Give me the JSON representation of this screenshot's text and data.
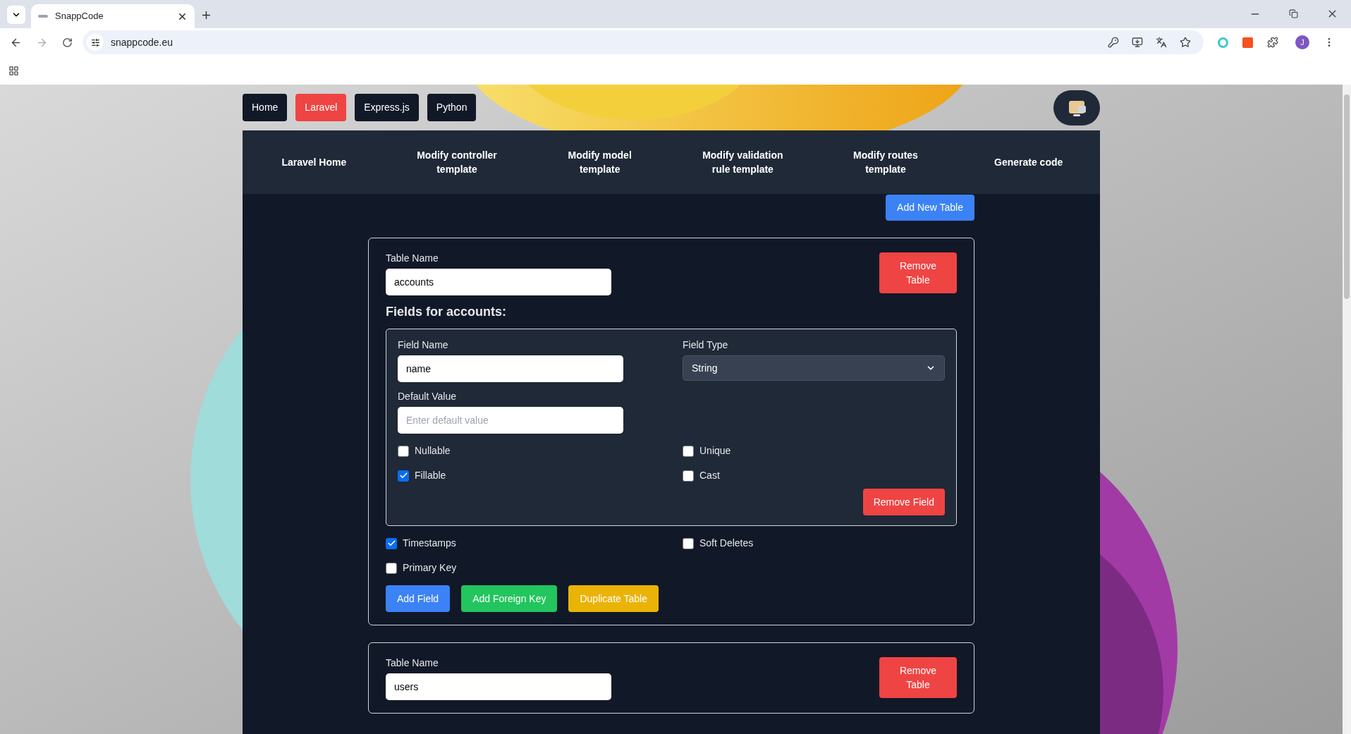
{
  "browser": {
    "tab_title": "SnappCode",
    "url": "snappcode.eu",
    "profile_initial": "J"
  },
  "site_nav": [
    {
      "label": "Home",
      "selected": false
    },
    {
      "label": "Laravel",
      "selected": true
    },
    {
      "label": "Express.js",
      "selected": false
    },
    {
      "label": "Python",
      "selected": false
    }
  ],
  "sub_nav": [
    "Laravel Home",
    "Modify controller template",
    "Modify model template",
    "Modify validation rule template",
    "Modify routes template",
    "Generate code"
  ],
  "add_table_button": "Add New Table",
  "tables": [
    {
      "table_name_label": "Table Name",
      "table_name": "accounts",
      "remove_button": "Remove Table",
      "fields_heading": "Fields for accounts:",
      "fields": [
        {
          "name_label": "Field Name",
          "name": "name",
          "type_label": "Field Type",
          "type": "String",
          "default_label": "Default Value",
          "default_placeholder": "Enter default value",
          "options": [
            {
              "label": "Nullable",
              "checked": false
            },
            {
              "label": "Unique",
              "checked": false
            },
            {
              "label": "Fillable",
              "checked": true
            },
            {
              "label": "Cast",
              "checked": false
            }
          ],
          "remove_button": "Remove Field"
        }
      ],
      "options": [
        {
          "label": "Timestamps",
          "checked": true
        },
        {
          "label": "Soft Deletes",
          "checked": false
        },
        {
          "label": "Primary Key",
          "checked": false
        }
      ],
      "buttons": [
        {
          "label": "Add Field",
          "color": "#3b82f6"
        },
        {
          "label": "Add Foreign Key",
          "color": "#22c55e"
        },
        {
          "label": "Duplicate Table",
          "color": "#eab308"
        }
      ]
    },
    {
      "table_name_label": "Table Name",
      "table_name": "users",
      "remove_button": "Remove Table"
    }
  ]
}
